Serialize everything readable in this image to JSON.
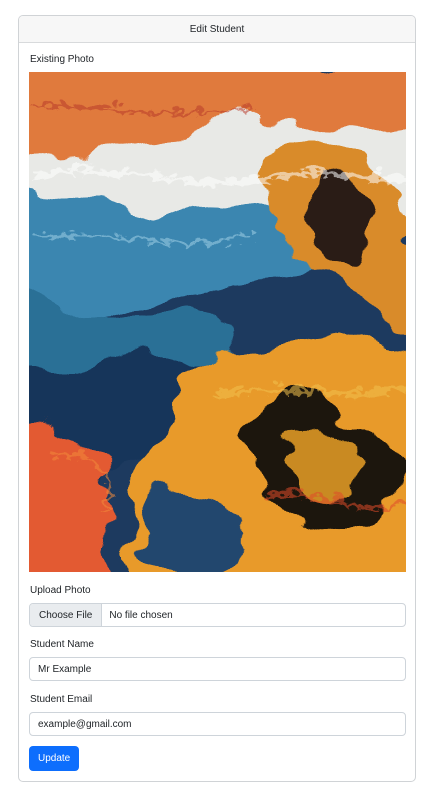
{
  "card": {
    "title": "Edit Student"
  },
  "photo": {
    "label": "Existing Photo"
  },
  "upload": {
    "label": "Upload Photo",
    "button_label": "Choose File",
    "status": "No file chosen"
  },
  "name": {
    "label": "Student Name",
    "value": "Mr Example"
  },
  "email": {
    "label": "Student Email",
    "value": "example@gmail.com"
  },
  "submit": {
    "label": "Update"
  },
  "colors": {
    "accent": "#0d6efd",
    "header_bg": "#f7f7f7",
    "border": "#ced4da"
  }
}
